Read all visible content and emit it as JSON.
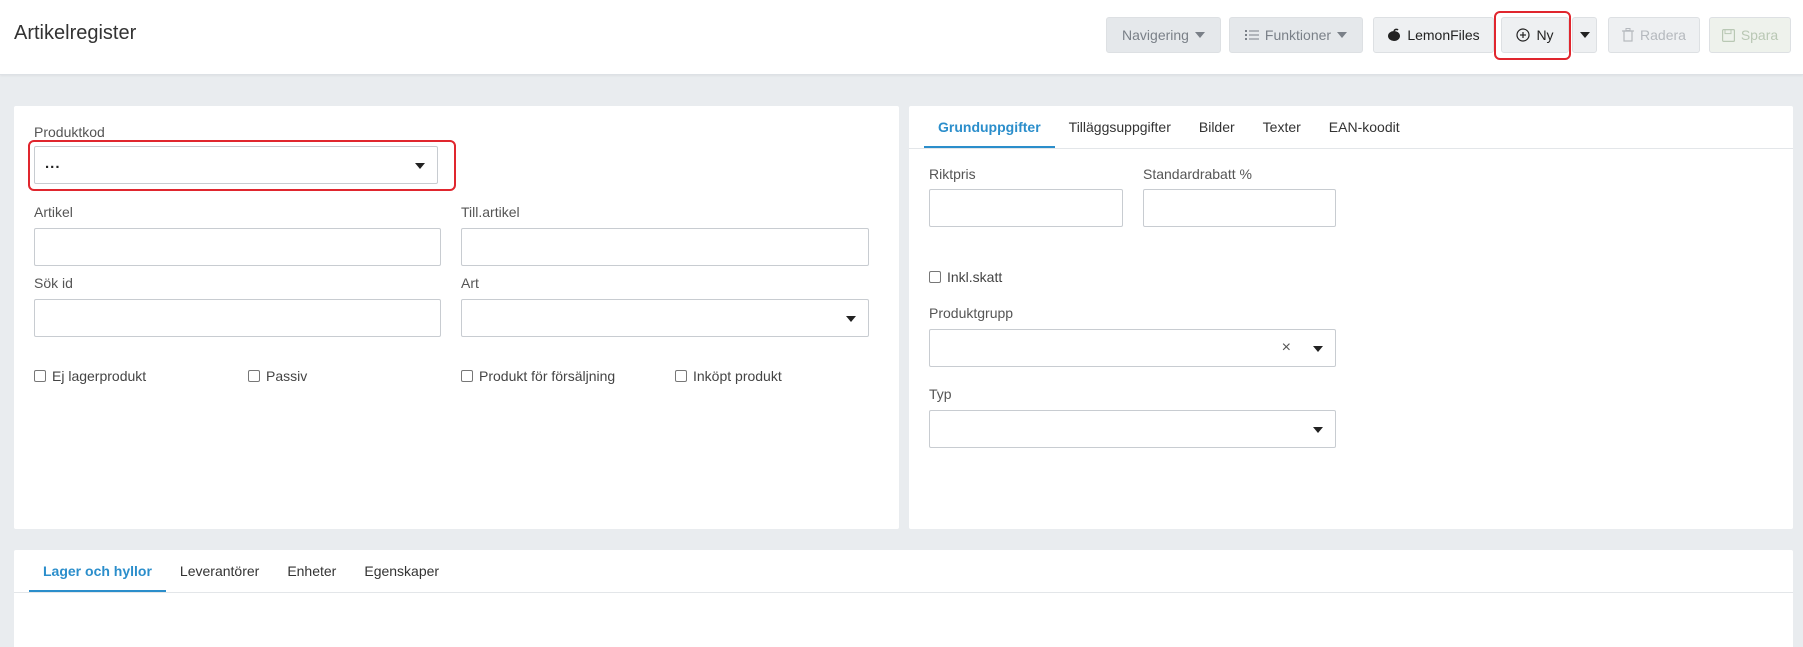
{
  "header": {
    "title": "Artikelregister",
    "toolbar": {
      "navigering": "Navigering",
      "funktioner": "Funktioner",
      "lemonfiles": "LemonFiles",
      "ny": "Ny",
      "radera": "Radera",
      "spara": "Spara"
    }
  },
  "left_form": {
    "produktkod": {
      "label": "Produktkod",
      "value": "..."
    },
    "artikel": {
      "label": "Artikel",
      "value": ""
    },
    "till_artikel": {
      "label": "Till.artikel",
      "value": ""
    },
    "sok_id": {
      "label": "Sök id",
      "value": ""
    },
    "art": {
      "label": "Art",
      "value": ""
    },
    "checkboxes": [
      {
        "label": "Ej lagerprodukt",
        "checked": false
      },
      {
        "label": "Passiv",
        "checked": false
      },
      {
        "label": "Produkt för försäljning",
        "checked": false
      },
      {
        "label": "Inköpt produkt",
        "checked": false
      }
    ]
  },
  "right_panel": {
    "tabs": [
      "Grunduppgifter",
      "Tilläggsuppgifter",
      "Bilder",
      "Texter",
      "EAN-koodit"
    ],
    "active_tab": "Grunduppgifter",
    "riktpris": {
      "label": "Riktpris",
      "value": ""
    },
    "standardrabatt": {
      "label": "Standardrabatt %",
      "value": ""
    },
    "inkl_skatt": {
      "label": "Inkl.skatt",
      "checked": false
    },
    "produktgrupp": {
      "label": "Produktgrupp",
      "value": "",
      "clear_icon": "×"
    },
    "typ": {
      "label": "Typ",
      "value": ""
    }
  },
  "bottom_panel": {
    "tabs": [
      "Lager och hyllor",
      "Leverantörer",
      "Enheter",
      "Egenskaper"
    ],
    "active_tab": "Lager och hyllor"
  },
  "colors": {
    "accent": "#2b8ecb",
    "highlight": "#e0262e"
  }
}
